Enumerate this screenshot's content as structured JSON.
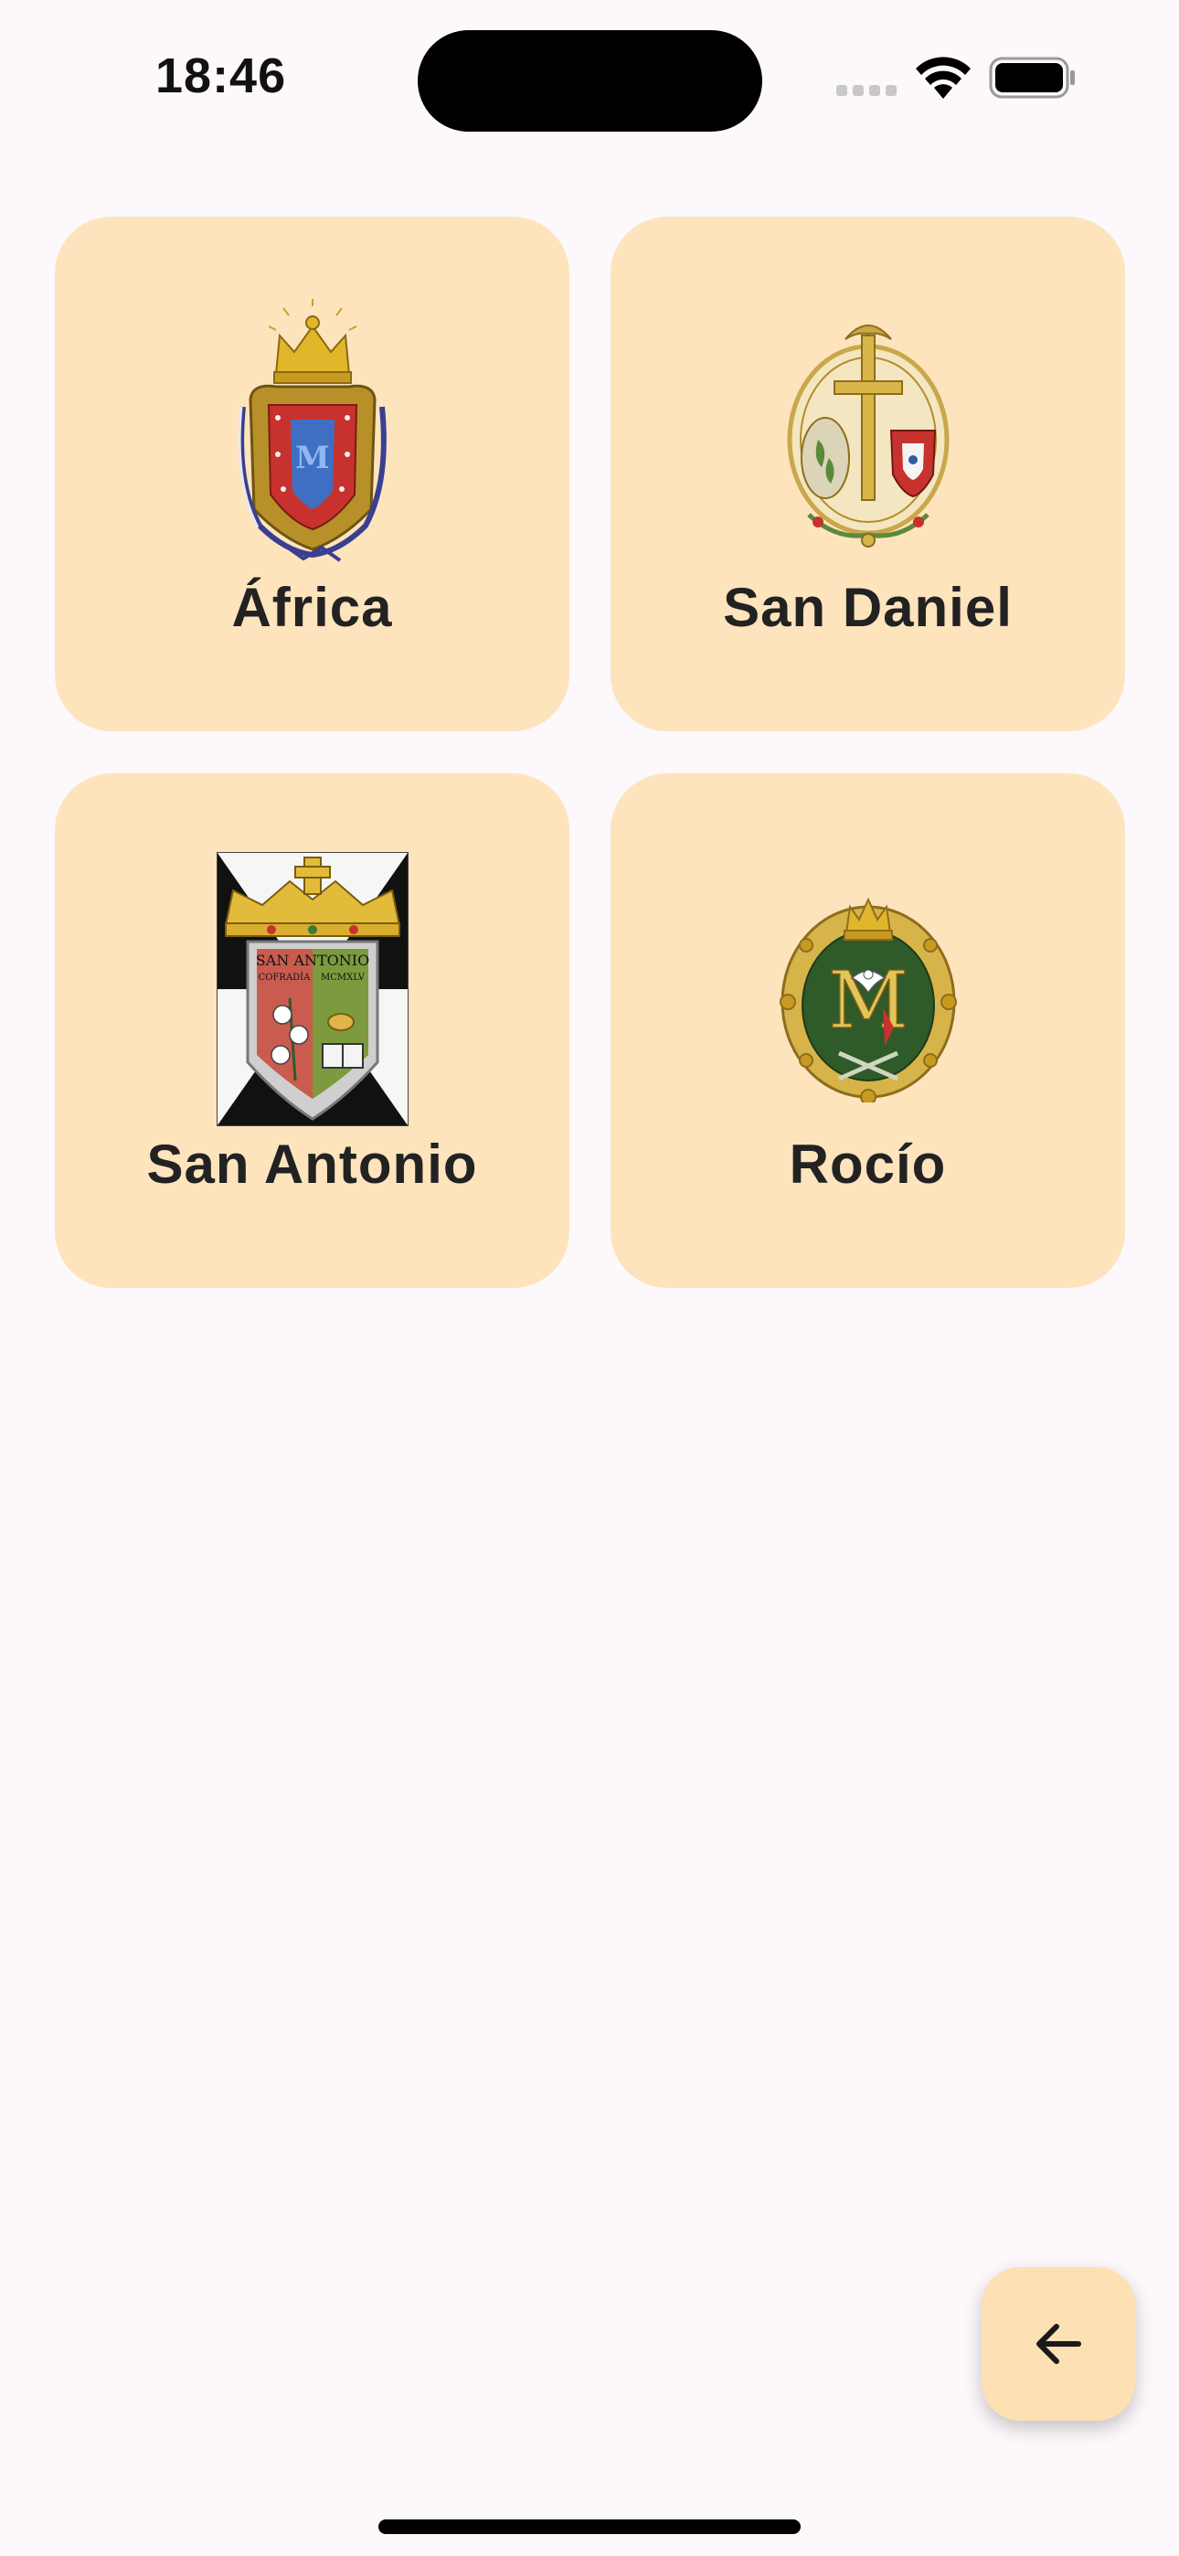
{
  "status_bar": {
    "time": "18:46"
  },
  "cards": [
    {
      "label": "África",
      "emblem": "africa-crest-icon"
    },
    {
      "label": "San Daniel",
      "emblem": "san-daniel-crest-icon"
    },
    {
      "label": "San Antonio",
      "emblem": "san-antonio-crest-icon",
      "emblem_text": [
        "SAN ANTONIO",
        "COFRADÍA",
        "MCMXLV"
      ]
    },
    {
      "label": "Rocío",
      "emblem": "rocio-crest-icon"
    }
  ],
  "fab": {
    "icon": "arrow-left-icon"
  },
  "colors": {
    "background": "#fdf8fb",
    "card": "#fde4bd",
    "fab": "#fde0b3",
    "text": "#222222"
  }
}
